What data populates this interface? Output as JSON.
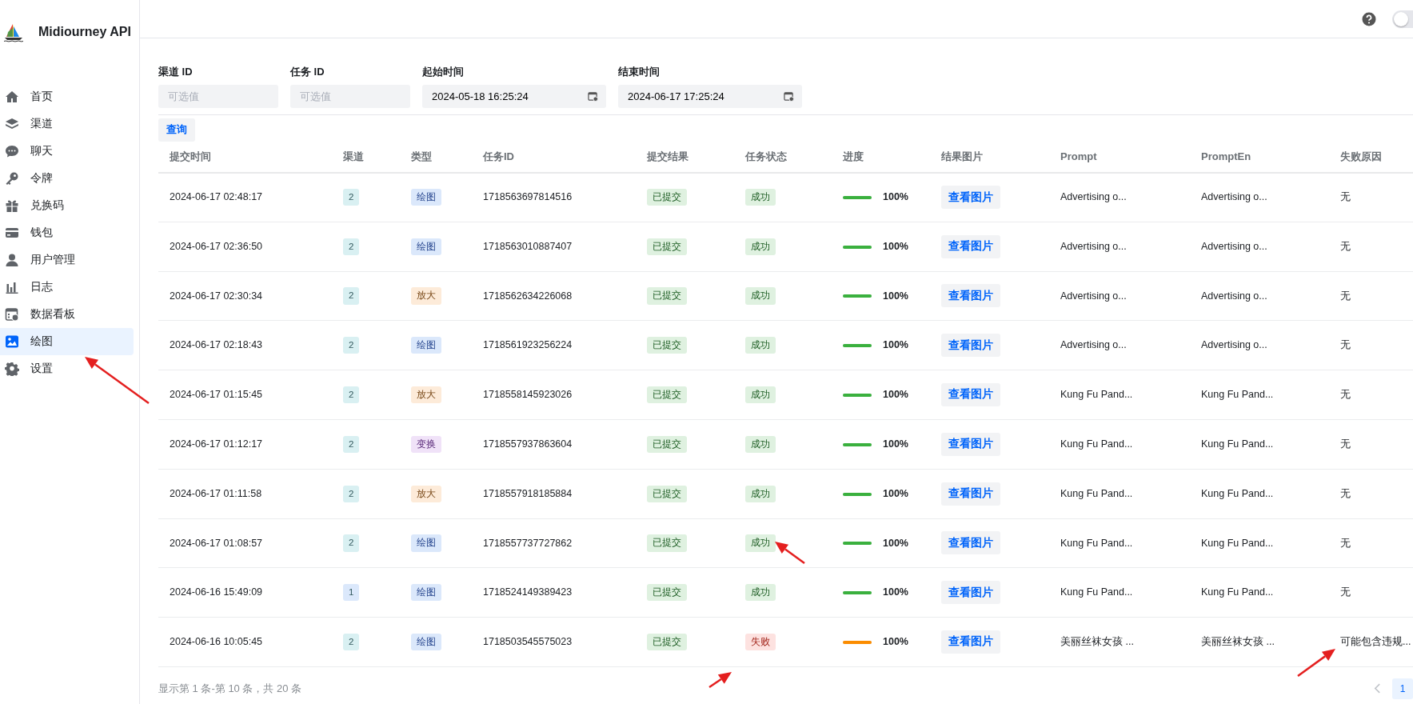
{
  "app": {
    "title": "Midiourney API"
  },
  "topbar": {
    "dark_mode": false
  },
  "sidebar": {
    "items": [
      {
        "label": "首页",
        "selected": false
      },
      {
        "label": "渠道",
        "selected": false
      },
      {
        "label": "聊天",
        "selected": false
      },
      {
        "label": "令牌",
        "selected": false
      },
      {
        "label": "兑换码",
        "selected": false
      },
      {
        "label": "钱包",
        "selected": false
      },
      {
        "label": "用户管理",
        "selected": false
      },
      {
        "label": "日志",
        "selected": false
      },
      {
        "label": "数据看板",
        "selected": false
      },
      {
        "label": "绘图",
        "selected": true
      },
      {
        "label": "设置",
        "selected": false
      }
    ]
  },
  "filters": [
    {
      "kind": "text",
      "label": "渠道 ID",
      "placeholder": "可选值"
    },
    {
      "kind": "text",
      "label": "任务 ID",
      "placeholder": "可选值"
    },
    {
      "kind": "date",
      "label": "起始时间",
      "value": "2024-05-18 16:25:24"
    },
    {
      "kind": "date",
      "label": "结束时间",
      "value": "2024-06-17 17:25:24"
    }
  ],
  "query_button": "查询",
  "table": {
    "columns": [
      "提交时间",
      "渠道",
      "类型",
      "任务ID",
      "提交结果",
      "任务状态",
      "进度",
      "结果图片",
      "Prompt",
      "PromptEn",
      "失败原因"
    ],
    "rows": [
      {
        "time": "2024-06-17 02:48:17",
        "channel": {
          "label": "2",
          "color": "#d9f0f2"
        },
        "type": {
          "label": "绘图",
          "kind": "draw"
        },
        "task_id": "1718563697814516",
        "submit": "已提交",
        "status": {
          "label": "成功",
          "kind": "success"
        },
        "level": 1,
        "progress": "100%",
        "image_button": "查看图片",
        "prompt": "Advertising o...",
        "prompt_en": "Advertising o...",
        "fail_reason": "无"
      },
      {
        "time": "2024-06-17 02:36:50",
        "channel": {
          "label": "2",
          "color": "#d9f0f2"
        },
        "type": {
          "label": "绘图",
          "kind": "draw"
        },
        "task_id": "1718563010887407",
        "submit": "已提交",
        "status": {
          "label": "成功",
          "kind": "success"
        },
        "level": 1,
        "progress": "100%",
        "image_button": "查看图片",
        "prompt": "Advertising o...",
        "prompt_en": "Advertising o...",
        "fail_reason": "无"
      },
      {
        "time": "2024-06-17 02:30:34",
        "channel": {
          "label": "2",
          "color": "#d9f0f2"
        },
        "type": {
          "label": "放大",
          "kind": "upscale"
        },
        "task_id": "1718562634226068",
        "submit": "已提交",
        "status": {
          "label": "成功",
          "kind": "success"
        },
        "level": 1,
        "progress": "100%",
        "image_button": "查看图片",
        "prompt": "Advertising o...",
        "prompt_en": "Advertising o...",
        "fail_reason": "无"
      },
      {
        "time": "2024-06-17 02:18:43",
        "channel": {
          "label": "2",
          "color": "#d9f0f2"
        },
        "type": {
          "label": "绘图",
          "kind": "draw"
        },
        "task_id": "1718561923256224",
        "submit": "已提交",
        "status": {
          "label": "成功",
          "kind": "success"
        },
        "level": 1,
        "progress": "100%",
        "image_button": "查看图片",
        "prompt": "Advertising o...",
        "prompt_en": "Advertising o...",
        "fail_reason": "无"
      },
      {
        "time": "2024-06-17 01:15:45",
        "channel": {
          "label": "2",
          "color": "#d9f0f2"
        },
        "type": {
          "label": "放大",
          "kind": "upscale"
        },
        "task_id": "1718558145923026",
        "submit": "已提交",
        "status": {
          "label": "成功",
          "kind": "success"
        },
        "level": 1,
        "progress": "100%",
        "image_button": "查看图片",
        "prompt": "Kung Fu Pand...",
        "prompt_en": "Kung Fu Pand...",
        "fail_reason": "无"
      },
      {
        "time": "2024-06-17 01:12:17",
        "channel": {
          "label": "2",
          "color": "#d9f0f2"
        },
        "type": {
          "label": "变换",
          "kind": "vary"
        },
        "task_id": "1718557937863604",
        "submit": "已提交",
        "status": {
          "label": "成功",
          "kind": "success"
        },
        "level": 1,
        "progress": "100%",
        "image_button": "查看图片",
        "prompt": "Kung Fu Pand...",
        "prompt_en": "Kung Fu Pand...",
        "fail_reason": "无"
      },
      {
        "time": "2024-06-17 01:11:58",
        "channel": {
          "label": "2",
          "color": "#d9f0f2"
        },
        "type": {
          "label": "放大",
          "kind": "upscale"
        },
        "task_id": "1718557918185884",
        "submit": "已提交",
        "status": {
          "label": "成功",
          "kind": "success"
        },
        "level": 1,
        "progress": "100%",
        "image_button": "查看图片",
        "prompt": "Kung Fu Pand...",
        "prompt_en": "Kung Fu Pand...",
        "fail_reason": "无"
      },
      {
        "time": "2024-06-17 01:08:57",
        "channel": {
          "label": "2",
          "color": "#d9f0f2"
        },
        "type": {
          "label": "绘图",
          "kind": "draw"
        },
        "task_id": "1718557737727862",
        "submit": "已提交",
        "status": {
          "label": "成功",
          "kind": "success"
        },
        "level": 1,
        "progress": "100%",
        "image_button": "查看图片",
        "prompt": "Kung Fu Pand...",
        "prompt_en": "Kung Fu Pand...",
        "fail_reason": "无"
      },
      {
        "time": "2024-06-16 15:49:09",
        "channel": {
          "label": "1",
          "color": "#dbe8fb"
        },
        "type": {
          "label": "绘图",
          "kind": "draw"
        },
        "task_id": "1718524149389423",
        "submit": "已提交",
        "status": {
          "label": "成功",
          "kind": "success"
        },
        "level": 1,
        "progress": "100%",
        "image_button": "查看图片",
        "prompt": "Kung Fu Pand...",
        "prompt_en": "Kung Fu Pand...",
        "fail_reason": "无"
      },
      {
        "time": "2024-06-16 10:05:45",
        "channel": {
          "label": "2",
          "color": "#d9f0f2"
        },
        "type": {
          "label": "绘图",
          "kind": "draw"
        },
        "task_id": "1718503545575023",
        "submit": "已提交",
        "status": {
          "label": "失败",
          "kind": "failure"
        },
        "level": 1,
        "progress": "100%",
        "image_button": "查看图片",
        "prompt": "美丽丝袜女孩 ...",
        "prompt_en": "美丽丝袜女孩 ...",
        "fail_reason": "可能包含违规..."
      }
    ]
  },
  "pagination": {
    "summary": "显示第 1 条-第 10 条，共 20 条",
    "prev_disabled": true,
    "pages": [
      {
        "label": "1",
        "selected": true
      }
    ]
  }
}
